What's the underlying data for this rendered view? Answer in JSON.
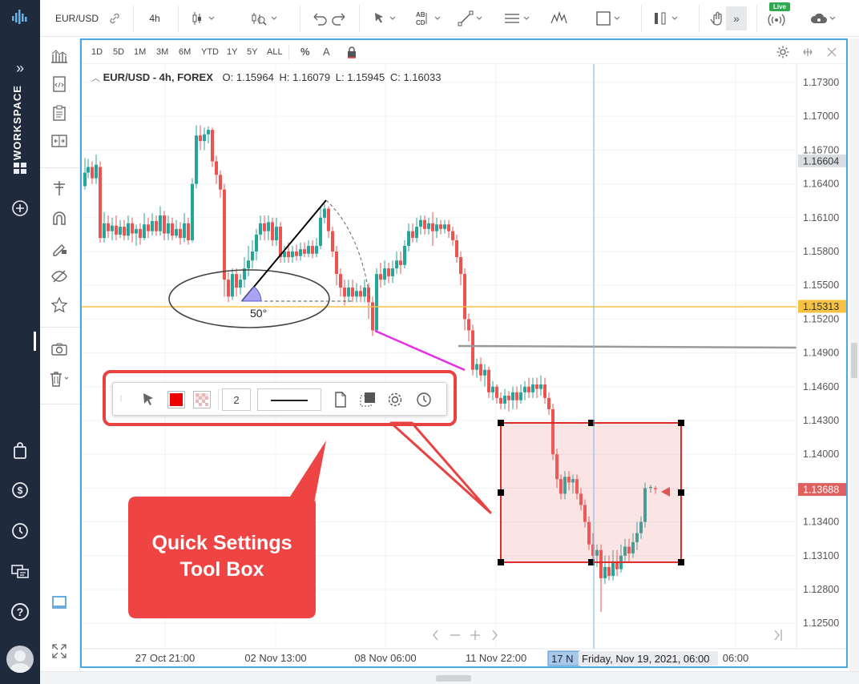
{
  "toolbar": {
    "symbol": "EUR/USD",
    "interval": "4h",
    "expand_label": "»",
    "live_badge": "Live"
  },
  "workspace": {
    "label": "WORKSPACE",
    "expand": "»"
  },
  "periods": [
    "1D",
    "5D",
    "1M",
    "3M",
    "6M",
    "YTD",
    "1Y",
    "5Y",
    "ALL"
  ],
  "scale_buttons": {
    "percent": "%",
    "auto": "A"
  },
  "legend": {
    "title": "EUR/USD - 4h, FOREX",
    "open_label": "O:",
    "open": "1.15964",
    "high_label": "H:",
    "high": "1.16079",
    "low_label": "L:",
    "low": "1.15945",
    "close_label": "C:",
    "close": "1.16033"
  },
  "price_axis": {
    "ticks": [
      "1.17300",
      "1.17000",
      "1.16700",
      "1.16400",
      "1.16100",
      "1.15800",
      "1.15500",
      "1.15200",
      "1.14900",
      "1.14600",
      "1.14300",
      "1.14000",
      "1.13700",
      "1.13400",
      "1.13100",
      "1.12800",
      "1.12500"
    ],
    "last_price": "1.16604",
    "hline_price": "1.15313",
    "crosshair_price": "1.13688",
    "colors": {
      "hline": "#f5c242",
      "crosshair": "#e06060",
      "last": "#d9dde2"
    }
  },
  "time_axis": {
    "ticks": [
      "27 Oct 21:00",
      "02 Nov 13:00",
      "08 Nov 06:00",
      "11 Nov 22:00",
      "06:00"
    ],
    "current_tag": "17 N",
    "crosshair_label": "Friday, Nov 19, 2021, 06:00"
  },
  "annotations": {
    "angle_label": "50°"
  },
  "quick_settings": {
    "line_width": "2"
  },
  "callout": {
    "line1": "Quick Settings",
    "line2": "Tool Box",
    "color": "#ee4444"
  },
  "colors": {
    "up": "#26a69a",
    "down": "#ef5350",
    "accent": "#4aa8e0",
    "workspace_bg": "#1f2a3c"
  }
}
